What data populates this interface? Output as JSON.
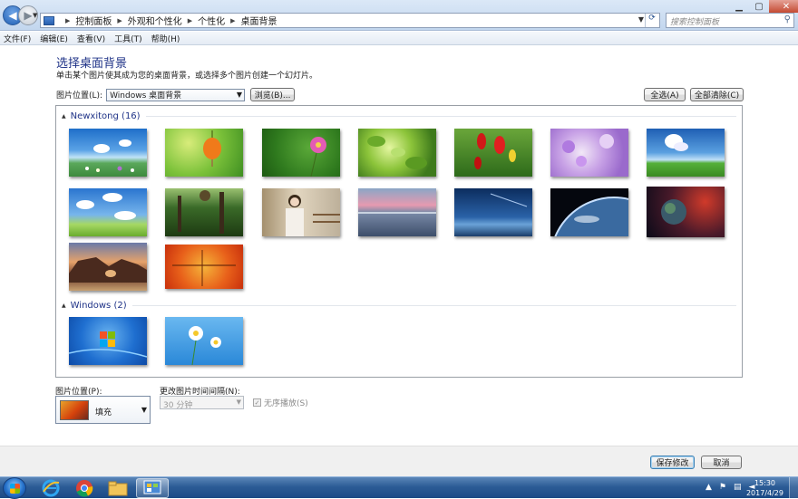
{
  "address": {
    "crumbs": [
      "控制面板",
      "外观和个性化",
      "个性化",
      "桌面背景"
    ],
    "search_placeholder": "搜索控制面板"
  },
  "menu": [
    "文件(F)",
    "编辑(E)",
    "查看(V)",
    "工具(T)",
    "帮助(H)"
  ],
  "page": {
    "title": "选择桌面背景",
    "subtitle": "单击某个图片使其成为您的桌面背景，或选择多个图片创建一个幻灯片。",
    "location_label": "图片位置(L):",
    "location_value": "Windows 桌面背景",
    "browse_label": "浏览(B)...",
    "select_all_label": "全选(A)",
    "clear_all_label": "全部清除(C)"
  },
  "groups": [
    {
      "title": "Newxitong (16)"
    },
    {
      "title": "Windows (2)"
    }
  ],
  "thumbnails": {
    "newxitong": [
      "sky-flowers",
      "orange-lantern-flower",
      "pink-cosmos",
      "green-leaves",
      "red-tulips",
      "purple-flowers",
      "sky-grassland",
      "clouds-blue-sky",
      "green-forest-path",
      "girl-portrait",
      "sunset-sea",
      "night-horizon",
      "earth-from-space",
      "planet-nebula",
      "rock-arch-coast",
      "orange-autumn"
    ],
    "windows": [
      "windows7-logo",
      "daisies-blue"
    ]
  },
  "bottom": {
    "position_label": "图片位置(P):",
    "position_value": "填充",
    "interval_label": "更改图片时间间隔(N):",
    "interval_value": "30 分钟",
    "shuffle_label": "无序播放(S)",
    "shuffle_check": "✓"
  },
  "footer": {
    "save_label": "保存修改",
    "cancel_label": "取消"
  },
  "taskbar": {
    "time": "15:30",
    "date": "2017/4/29"
  }
}
